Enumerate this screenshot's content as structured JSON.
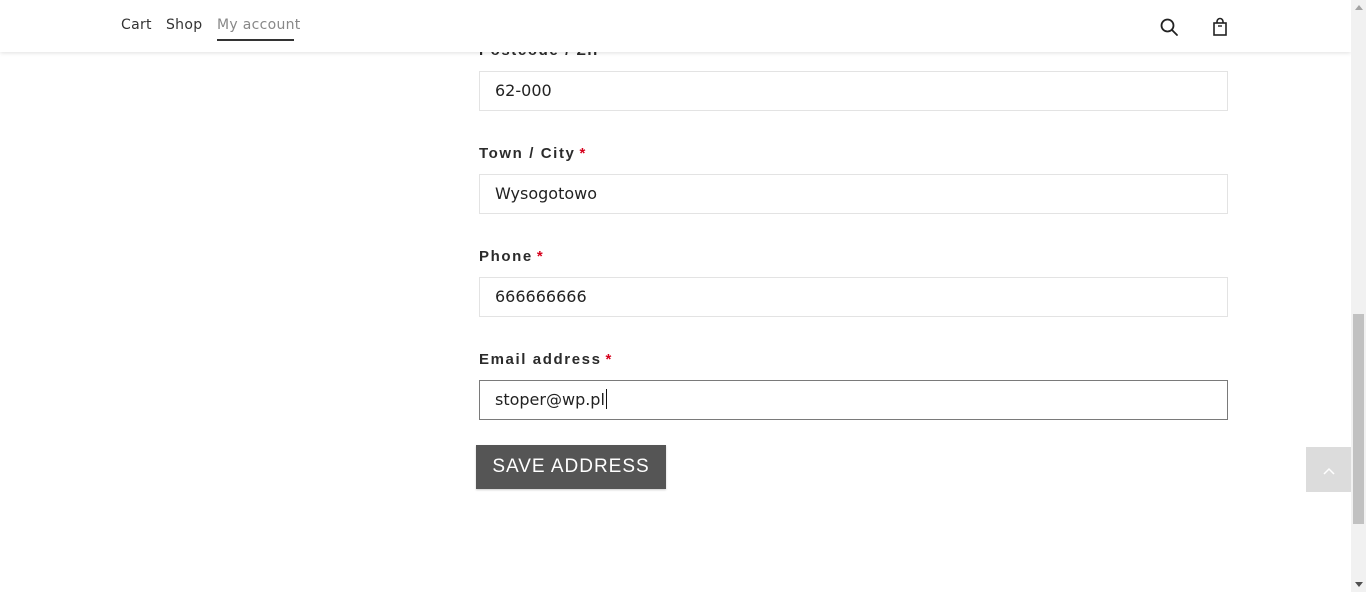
{
  "nav": {
    "items": [
      {
        "label": "Cart"
      },
      {
        "label": "Shop"
      },
      {
        "label": "My account"
      }
    ],
    "active": "My account",
    "icons": [
      "search-icon",
      "shopping-bag-icon"
    ]
  },
  "form": {
    "postcode": {
      "label": "Postcode / ZIP",
      "required_mark": "*",
      "value": "62-000"
    },
    "city": {
      "label": "Town / City",
      "required_mark": "*",
      "value": "Wysogotowo"
    },
    "phone": {
      "label": "Phone",
      "required_mark": "*",
      "value": "666666666"
    },
    "email": {
      "label": "Email address",
      "required_mark": "*",
      "value": "stoper@wp.pl"
    },
    "save_label": "SAVE ADDRESS"
  },
  "colors": {
    "required": "#d6001c",
    "button_bg": "#555555",
    "back_to_top_bg": "#dcdcdc"
  }
}
